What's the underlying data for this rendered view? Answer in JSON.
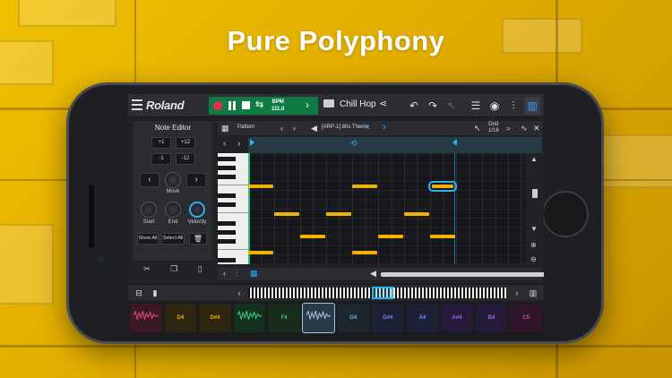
{
  "headline": "Pure Polyphony",
  "app": {
    "brand": "Roland",
    "bpm_label": "BPM",
    "bpm_value": "111.0",
    "song_name": "Chill Hop"
  },
  "note_editor": {
    "title": "Note Editor",
    "buttons": [
      "+1",
      "+12",
      "-1",
      "-12"
    ],
    "move_label": "Move",
    "knobs": [
      "Start",
      "End",
      "Velocity"
    ],
    "show_all": "Show All",
    "select_all": "Select All"
  },
  "piano_roll": {
    "pattern_label": "Pattern",
    "instrument": "[ARP-1] 80s Theme",
    "grid_label": "Grid",
    "grid_value": "1/16"
  },
  "pads": [
    {
      "label": "",
      "color": "#3b1824",
      "text_color": "#e04a7a"
    },
    {
      "label": "D4",
      "color": "#2f2612",
      "text_color": "#f0b400"
    },
    {
      "label": "D#4",
      "color": "#2f2612",
      "text_color": "#f0b400"
    },
    {
      "label": "",
      "color": "#14301f",
      "text_color": "#3ccf7a"
    },
    {
      "label": "F4",
      "color": "#1a2c1c",
      "text_color": "#3ccf7a"
    },
    {
      "label": "",
      "color": "#2c3a46",
      "text_color": "#9fc8e0"
    },
    {
      "label": "G4",
      "color": "#1c2730",
      "text_color": "#7ab8e0"
    },
    {
      "label": "G#4",
      "color": "#1c2136",
      "text_color": "#6f8fe8"
    },
    {
      "label": "A4",
      "color": "#1c2136",
      "text_color": "#6f8fe8"
    },
    {
      "label": "A#4",
      "color": "#26193a",
      "text_color": "#a16ae8"
    },
    {
      "label": "B4",
      "color": "#26193a",
      "text_color": "#a16ae8"
    },
    {
      "label": "C5",
      "color": "#30162a",
      "text_color": "#d64a9a"
    }
  ]
}
